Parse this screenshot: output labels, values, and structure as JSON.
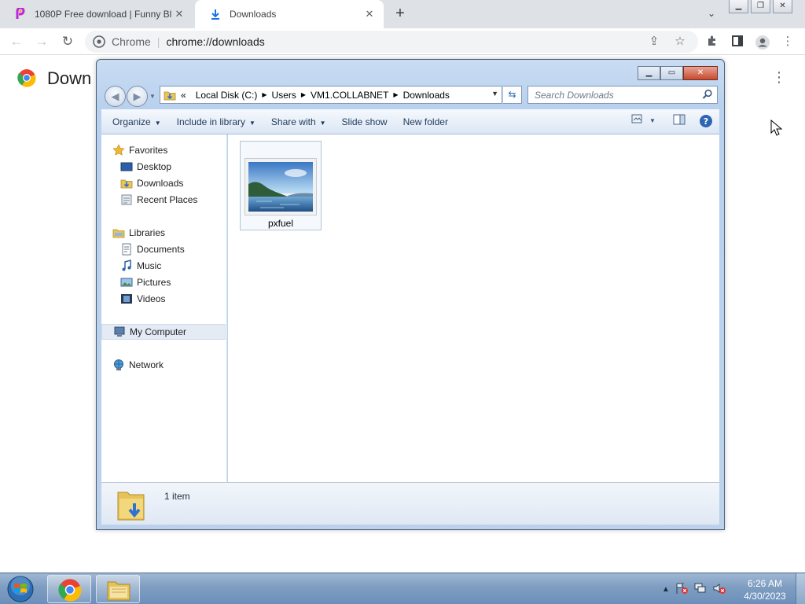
{
  "browser": {
    "tabs": [
      {
        "title": "1080P Free download | Funny Bl",
        "icon": "picsart-icon",
        "active": false
      },
      {
        "title": "Downloads",
        "icon": "download-icon",
        "active": true
      }
    ],
    "new_tab_symbol": "+",
    "omnibox": {
      "site_label": "Chrome",
      "url": "chrome://downloads"
    },
    "page_title": "Down",
    "accent": "#1a73e8"
  },
  "explorer": {
    "breadcrumb": [
      "«",
      "Local Disk (C:)",
      "Users",
      "VM1.COLLABNET",
      "Downloads"
    ],
    "search_placeholder": "Search Downloads",
    "commands": [
      "Organize",
      "Include in library",
      "Share with",
      "Slide show",
      "New folder"
    ],
    "nav": {
      "favorites": {
        "label": "Favorites",
        "items": [
          "Desktop",
          "Downloads",
          "Recent Places"
        ]
      },
      "libraries": {
        "label": "Libraries",
        "items": [
          "Documents",
          "Music",
          "Pictures",
          "Videos"
        ]
      },
      "computer": "My Computer",
      "network": "Network"
    },
    "files": [
      {
        "name": "pxfuel",
        "type": "image"
      }
    ],
    "status": "1 item"
  },
  "taskbar": {
    "clock_time": "6:26 AM",
    "clock_date": "4/30/2023",
    "tray_arrow": "▲"
  }
}
